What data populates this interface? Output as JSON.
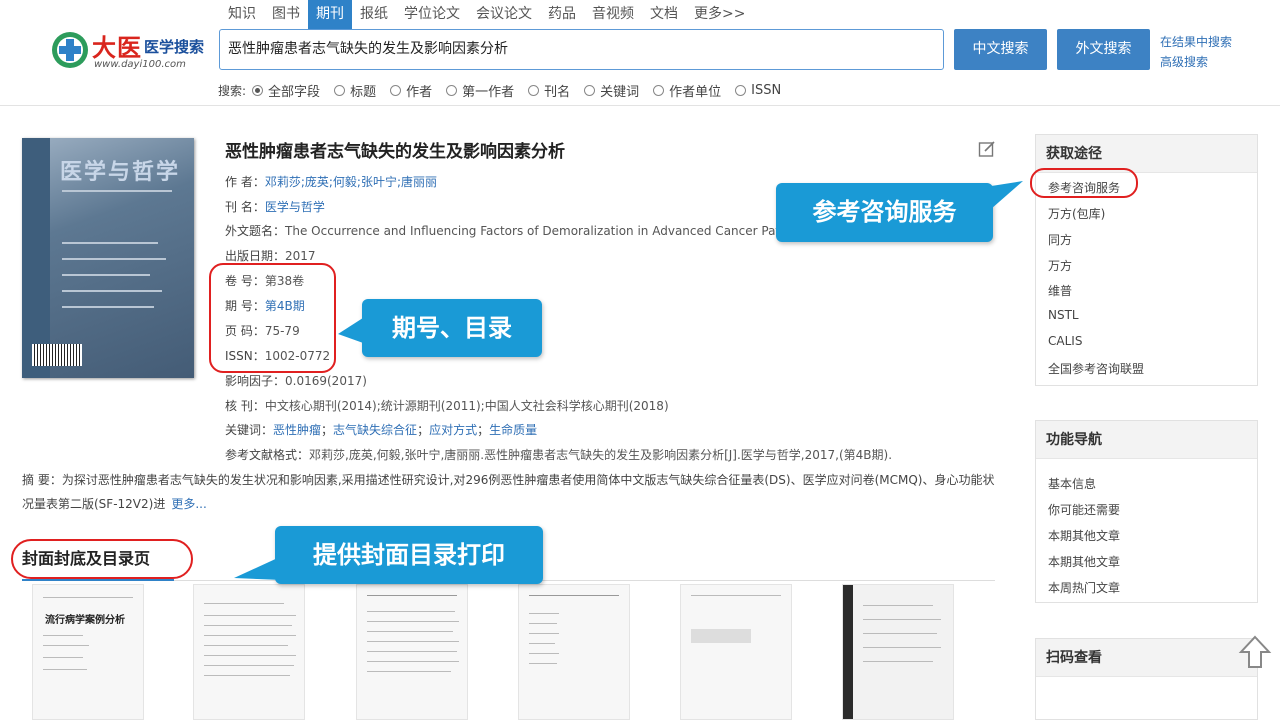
{
  "logo": {
    "brand": "大医",
    "sub": "医学搜索",
    "url": "www.dayi100.com"
  },
  "nav": {
    "tabs": [
      "知识",
      "图书",
      "期刊",
      "报纸",
      "学位论文",
      "会议论文",
      "药品",
      "音视频",
      "文档",
      "更多>>"
    ],
    "active": 2
  },
  "search": {
    "value": "恶性肿瘤患者志气缺失的发生及影响因素分析",
    "cn_button": "中文搜索",
    "en_button": "外文搜索",
    "in_results": "在结果中搜索",
    "advanced": "高级搜索"
  },
  "filters": {
    "label": "搜索:",
    "options": [
      "全部字段",
      "标题",
      "作者",
      "第一作者",
      "刊名",
      "关键词",
      "作者单位",
      "ISSN"
    ],
    "selected": 0
  },
  "cover": {
    "title": "医学与哲学"
  },
  "article": {
    "title": "恶性肿瘤患者志气缺失的发生及影响因素分析",
    "authors_label": "作 者：",
    "authors": "邓莉莎;庞英;何毅;张叶宁;唐丽丽",
    "journal_label": "刊 名：",
    "journal": "医学与哲学",
    "foreign_label": "外文题名：",
    "foreign_title": "The Occurrence and Influencing Factors of Demoralization in Advanced Cancer Patien",
    "date_label": "出版日期：",
    "date": "2017",
    "volume_label": "卷 号：",
    "volume": "第38卷",
    "issue_label": "期 号：",
    "issue": "第4B期",
    "pages_label": "页 码：",
    "pages": "75-79",
    "issn_label": "ISSN：",
    "issn": "1002-0772",
    "impact_label": "影响因子：",
    "impact": "0.0169(2017)",
    "core_label": "核 刊：",
    "core": "中文核心期刊(2014);统计源期刊(2011);中国人文社会科学核心期刊(2018)",
    "keywords_label": "关键词：",
    "keywords": [
      "恶性肿瘤",
      "志气缺失综合征",
      "应对方式",
      "生命质量"
    ],
    "cite_label": "参考文献格式：",
    "cite": "邓莉莎,庞英,何毅,张叶宁,唐丽丽.恶性肿瘤患者志气缺失的发生及影响因素分析[J].医学与哲学,2017,(第4B期).",
    "abstract_label": "摘 要：",
    "abstract": "为探讨恶性肿瘤患者志气缺失的发生状况和影响因素,采用描述性研究设计,对296例恶性肿瘤患者使用简体中文版志气缺失综合征量表(DS)、医学应对问卷(MCMQ)、身心功能状况量表第二版(SF-12V2)进",
    "more": "更多..."
  },
  "section": {
    "title": "封面封底及目录页",
    "thumb1_title": "流行病学案例分析"
  },
  "sidebar": {
    "access_title": "获取途径",
    "access_items": [
      "参考咨询服务",
      "万方(包库)",
      "同方",
      "万方",
      "维普",
      "NSTL",
      "CALIS",
      "全国参考咨询联盟"
    ],
    "func_title": "功能导航",
    "func_items": [
      "基本信息",
      "你可能还需要",
      "本期其他文章",
      "本期其他文章",
      "本周热门文章"
    ],
    "qr_title": "扫码查看"
  },
  "callouts": {
    "ref_service": "参考咨询服务",
    "issue_toc": "期号、目录",
    "print_toc": "提供封面目录打印"
  },
  "colors": {
    "accent": "#2f82c8",
    "callout": "#1a9ad6",
    "ring": "#e02020"
  }
}
